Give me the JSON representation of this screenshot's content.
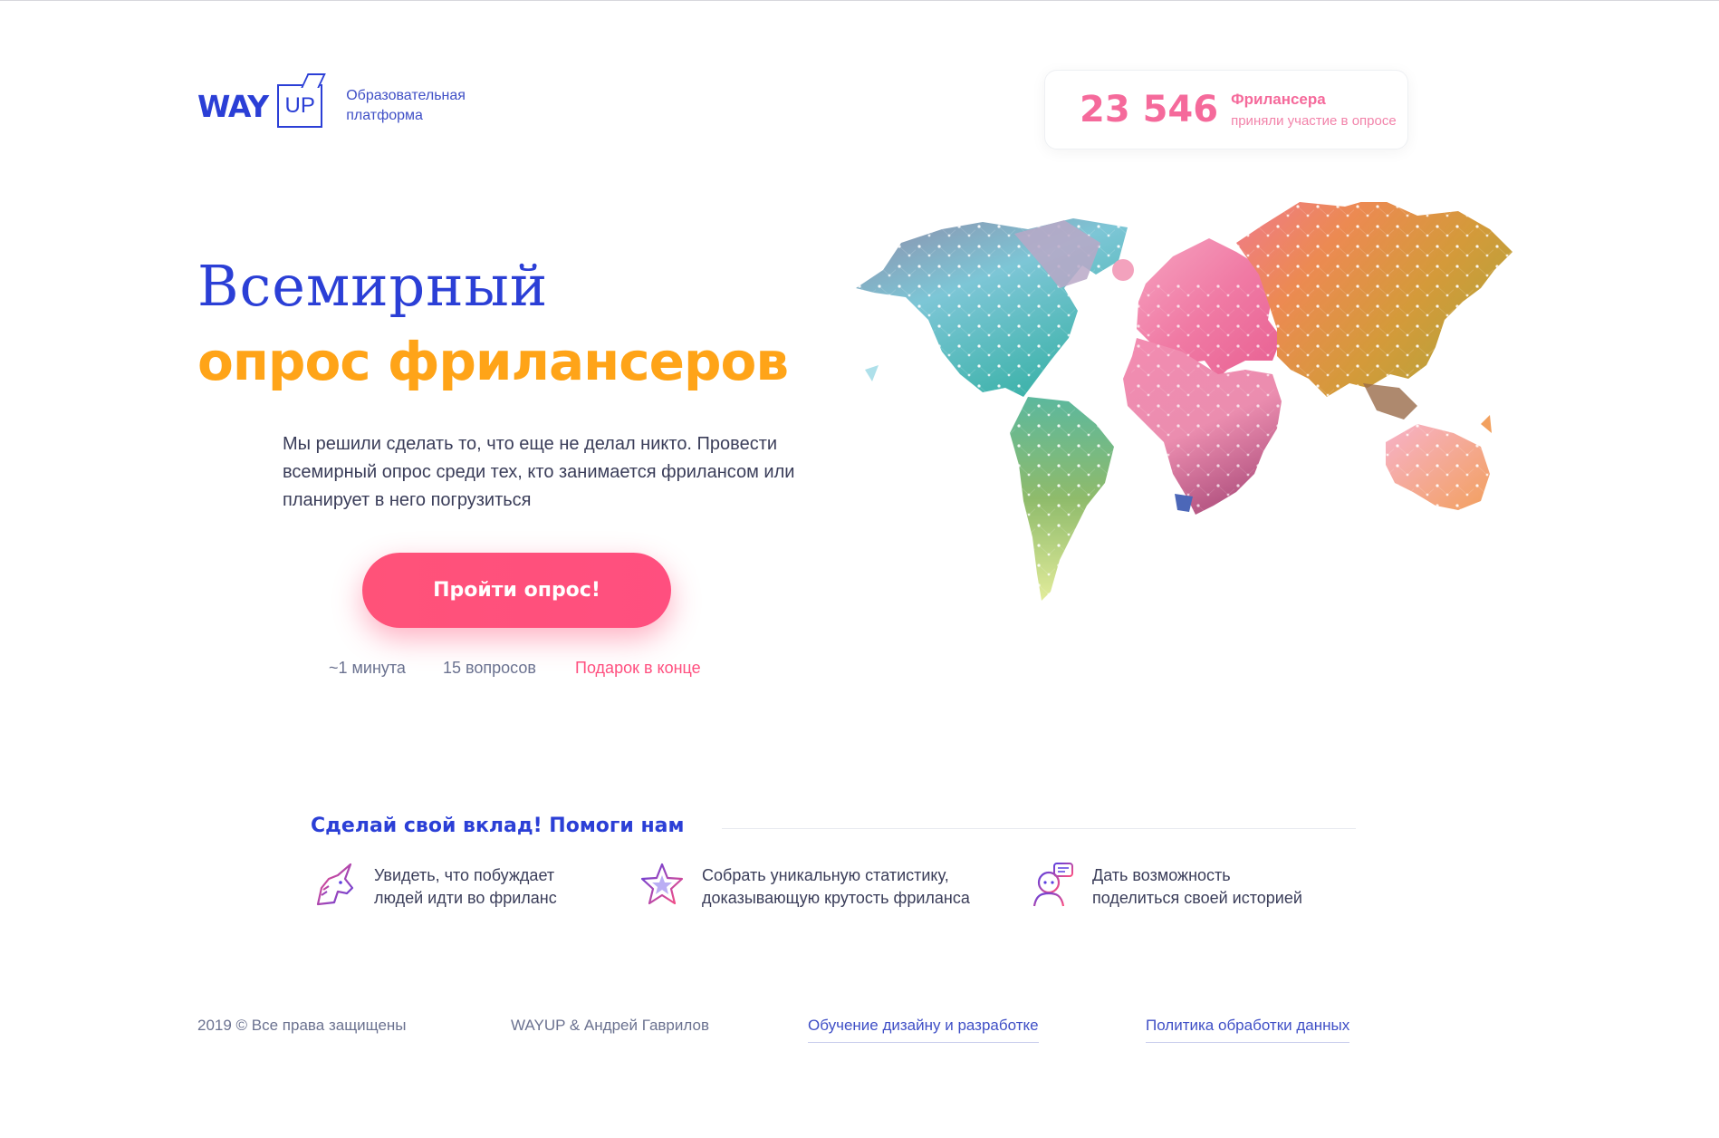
{
  "header": {
    "logo_way": "WAY",
    "logo_up": "UP",
    "logo_sub_line1": "Образовательная",
    "logo_sub_line2": "платформа",
    "counter_value": "23 546",
    "counter_title": "Фрилансера",
    "counter_sub": "приняли участие в опросе"
  },
  "hero": {
    "title_line1": "Всемирный",
    "title_line2": "опрос фрилансеров",
    "description": "Мы решили сделать то, что еще не делал никто. Провести всемирный опрос среди тех, кто занимается фрилансом или планирует в него погрузиться",
    "cta_label": "Пройти опрос!",
    "meta_time": "~1 минута",
    "meta_questions": "15 вопросов",
    "meta_gift": "Подарок в конце"
  },
  "contribute": {
    "title": "Сделай свой вклад! Помоги нам",
    "features": [
      {
        "icon": "unicorn-icon",
        "line1": "Увидеть, что побуждает",
        "line2": "людей идти во фриланс"
      },
      {
        "icon": "star-icon",
        "line1": "Собрать уникальную статистику,",
        "line2": "доказывающую крутость фриланса"
      },
      {
        "icon": "person-chat-icon",
        "line1": "Дать возможность",
        "line2": "поделиться своей историей"
      }
    ]
  },
  "footer": {
    "copyright": "2019 © Все права защищены",
    "authors": "WAYUP & Андрей Гаврилов",
    "link_learning": "Обучение дизайну и разработке",
    "link_policy": "Политика обработки данных"
  },
  "colors": {
    "brand_blue": "#2b3fd6",
    "accent_orange": "#ffa418",
    "accent_pink": "#ff4f7f"
  }
}
